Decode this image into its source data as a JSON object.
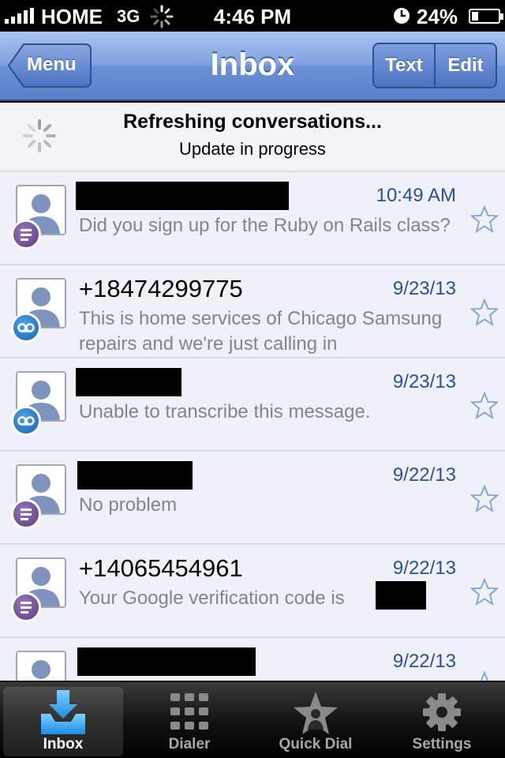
{
  "status_bar": {
    "carrier": "HOME",
    "network": "3G",
    "time": "4:46 PM",
    "battery_percent": "24%",
    "battery_level": 0.24,
    "icons": [
      "signal-bars-icon",
      "activity-spinner-icon",
      "clock-icon",
      "battery-icon"
    ]
  },
  "nav": {
    "back_label": "Menu",
    "title": "Inbox",
    "text_label": "Text",
    "edit_label": "Edit"
  },
  "refresh": {
    "title": "Refreshing conversations...",
    "subtitle": "Update in progress"
  },
  "conversations": [
    {
      "name": "",
      "redacted_name": true,
      "date": "10:49 AM",
      "snippet": "Did you sign up for the Ruby on Rails class?",
      "type": "message",
      "starred": false
    },
    {
      "name": "+18474299775",
      "redacted_name": false,
      "date": "9/23/13",
      "snippet": "This is home services of Chicago Samsung repairs and we're just calling in",
      "type": "voicemail",
      "starred": false
    },
    {
      "name": "",
      "redacted_name": true,
      "date": "9/23/13",
      "snippet": "Unable to transcribe this message.",
      "type": "voicemail",
      "starred": false
    },
    {
      "name": "",
      "redacted_name": true,
      "date": "9/22/13",
      "snippet": "No problem",
      "type": "message",
      "starred": false
    },
    {
      "name": "+14065454961",
      "redacted_name": false,
      "date": "9/22/13",
      "snippet": "Your Google verification code is",
      "type": "message",
      "starred": false
    },
    {
      "name": "",
      "redacted_name": true,
      "date": "9/22/13",
      "snippet": "",
      "type": "message",
      "starred": false
    }
  ],
  "tabs": [
    {
      "label": "Inbox",
      "icon": "inbox-download-icon",
      "active": true
    },
    {
      "label": "Dialer",
      "icon": "keypad-icon",
      "active": false
    },
    {
      "label": "Quick Dial",
      "icon": "star-person-icon",
      "active": false
    },
    {
      "label": "Settings",
      "icon": "gear-icon",
      "active": false
    }
  ],
  "colors": {
    "nav_blue": "#6b90d6",
    "date_blue": "#2c4f96",
    "snippet_gray": "#7f868f",
    "message_badge": "#6a4a90",
    "voicemail_badge": "#2a7fd0"
  }
}
